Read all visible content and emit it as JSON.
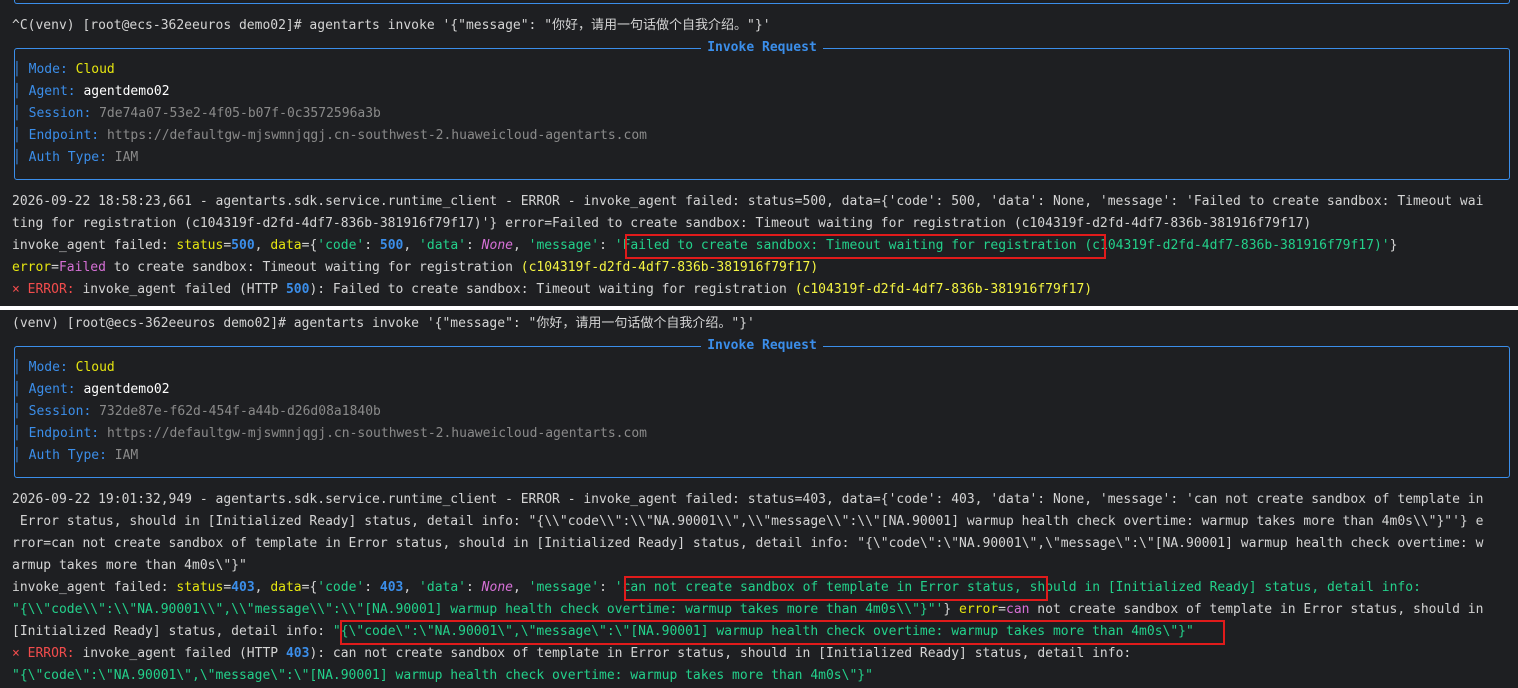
{
  "t1": {
    "cmd": "^C(venv) [root@ecs-362eeuros demo02]# agentarts invoke '{\"message\": \"你好，请用一句话做个自我介绍。\"}'",
    "box_title": "Invoke Request",
    "mode_key": "Mode:",
    "mode_val": "Cloud",
    "agent_key": "Agent:",
    "agent_val": "agentdemo02",
    "session_key": "Session:",
    "session_val": "7de74a07-53e2-4f05-b07f-0c3572596a3b",
    "endpoint_key": "Endpoint:",
    "endpoint_val": "https://defaultgw-mjswmnjqgj.cn-southwest-2.huaweicloud-agentarts.com",
    "auth_key": "Auth Type:",
    "auth_val": "IAM",
    "log1": "2026-09-22 18:58:23,661 - agentarts.sdk.service.runtime_client - ERROR - invoke_agent failed: status=500, data={'code': 500, 'data': None, 'message': 'Failed to create sandbox: Timeout wai",
    "log2": "ting for registration (c104319f-d2fd-4df7-836b-381916f79f17)'} error=Failed to create sandbox: Timeout waiting for registration (c104319f-d2fd-4df7-836b-381916f79f17)",
    "l3a": "invoke_agent failed: ",
    "l3b": "status",
    "l3c": "=",
    "l3d": "500",
    "l3e": ", ",
    "l3f": "data",
    "l3g": "={",
    "l3h": "'code'",
    "l3i": ": ",
    "l3j": "500",
    "l3k": ", ",
    "l3l": "'data'",
    "l3m": ": ",
    "l3n": "None",
    "l3o": ", ",
    "l3p": "'message'",
    "l3q": ": ",
    "l3r": "'Failed to create sandbox: Timeout waiting for registration ",
    "l3s": "(c104319f-d2fd-4df7-836b-381916f79f17)'",
    "l3t": "}",
    "l4a": "error",
    "l4b": "=",
    "l4c": "Failed",
    "l4d": " to create sandbox: Timeout waiting for registration ",
    "l4e": "(c104319f-d2fd-4df7-836b-381916f79f17)",
    "l5a": "× ERROR:",
    "l5b": " invoke_agent failed (HTTP ",
    "l5c": "500",
    "l5d": "): Failed to create sandbox: Timeout waiting for registration ",
    "l5e": "(c104319f-d2fd-4df7-836b-381916f79f17)"
  },
  "t2": {
    "cmd": "(venv) [root@ecs-362eeuros demo02]# agentarts invoke '{\"message\": \"你好，请用一句话做个自我介绍。\"}'",
    "box_title": "Invoke Request",
    "mode_key": "Mode:",
    "mode_val": "Cloud",
    "agent_key": "Agent:",
    "agent_val": "agentdemo02",
    "session_key": "Session:",
    "session_val": "732de87e-f62d-454f-a44b-d26d08a1840b",
    "endpoint_key": "Endpoint:",
    "endpoint_val": "https://defaultgw-mjswmnjqgj.cn-southwest-2.huaweicloud-agentarts.com",
    "auth_key": "Auth Type:",
    "auth_val": "IAM",
    "log1": "2026-09-22 19:01:32,949 - agentarts.sdk.service.runtime_client - ERROR - invoke_agent failed: status=403, data={'code': 403, 'data': None, 'message': 'can not create sandbox of template in",
    "log2": " Error status, should in [Initialized Ready] status, detail info: \"{\\\\\"code\\\\\":\\\\\"NA.90001\\\\\",\\\\\"message\\\\\":\\\\\"[NA.90001] warmup health check overtime: warmup takes more than 4m0s\\\\\"}\"'} e",
    "log3": "rror=can not create sandbox of template in Error status, should in [Initialized Ready] status, detail info: \"{\\\"code\\\":\\\"NA.90001\\\",\\\"message\\\":\\\"[NA.90001] warmup health check overtime: w",
    "log4": "armup takes more than 4m0s\\\"}\"",
    "l5a": "invoke_agent failed: ",
    "l5b": "status",
    "l5c": "=",
    "l5d": "403",
    "l5e": ", ",
    "l5f": "data",
    "l5g": "={",
    "l5h": "'code'",
    "l5i": ": ",
    "l5j": "403",
    "l5k": ", ",
    "l5l": "'data'",
    "l5m": ": ",
    "l5n": "None",
    "l5o": ", ",
    "l5p": "'message'",
    "l5q": ": ",
    "l5r": "'can not create sandbox of template in Error status,",
    "l5s": " should in [Initialized Ready] status, detail info:",
    "l6a": "\"{\\\\\"code\\\\\":\\\\\"NA.90001\\\\\",\\\\\"message\\\\\":\\\\\"[NA.90001] warmup health check overtime: warmup takes more than 4m0s\\\\\"}\"'",
    "l6b": "} ",
    "l6c": "error",
    "l6d": "=",
    "l6e": "can",
    "l6f": " not create sandbox of template in Error status, should in",
    "l7a": "[Initialized Ready] status, detail info: ",
    "l7b": "\"{\\\"code\\\":\\\"NA.90001\\\",\\\"message\\\":\\\"[NA.90001] warmup health check overtime: warmup takes more than 4m0s\\\"}\"",
    "l8a": "× ERROR:",
    "l8b": " invoke_agent failed (HTTP ",
    "l8c": "403",
    "l8d": "): can not create sandbox of template in Error status, should in [Initialized Ready] status, detail info:",
    "l9": "\"{\\\"code\\\":\\\"NA.90001\\\",\\\"message\\\":\\\"[NA.90001] warmup health check overtime: warmup takes more than 4m0s\\\"}\""
  }
}
